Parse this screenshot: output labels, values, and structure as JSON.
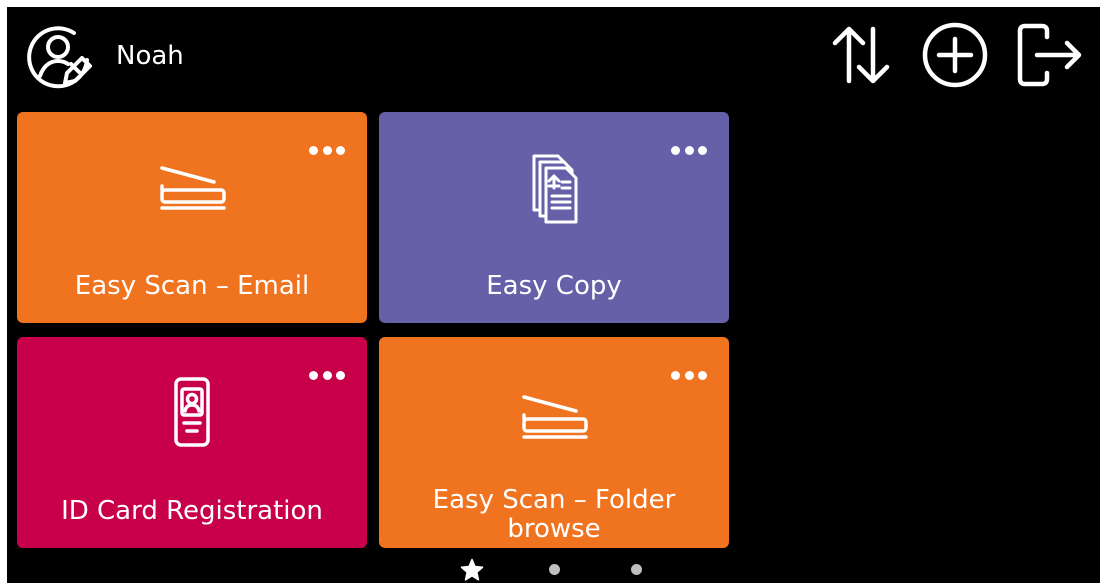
{
  "user": {
    "name": "Noah"
  },
  "tiles": [
    {
      "label": "Easy Scan – Email",
      "color": "#f07320",
      "icon": "scanner-icon"
    },
    {
      "label": "Easy Copy",
      "color": "#6560a8",
      "icon": "copy-documents-icon"
    },
    {
      "label": "ID Card Registration",
      "color": "#c8004a",
      "icon": "id-card-icon"
    },
    {
      "label": "Easy Scan – Folder browse",
      "color": "#f07320",
      "icon": "scanner-icon"
    }
  ],
  "toolbar": {
    "icons": [
      "sort-arrows-icon",
      "add-circle-icon",
      "logout-icon"
    ]
  },
  "pager": {
    "active": "favorites-star",
    "pages": 3
  }
}
